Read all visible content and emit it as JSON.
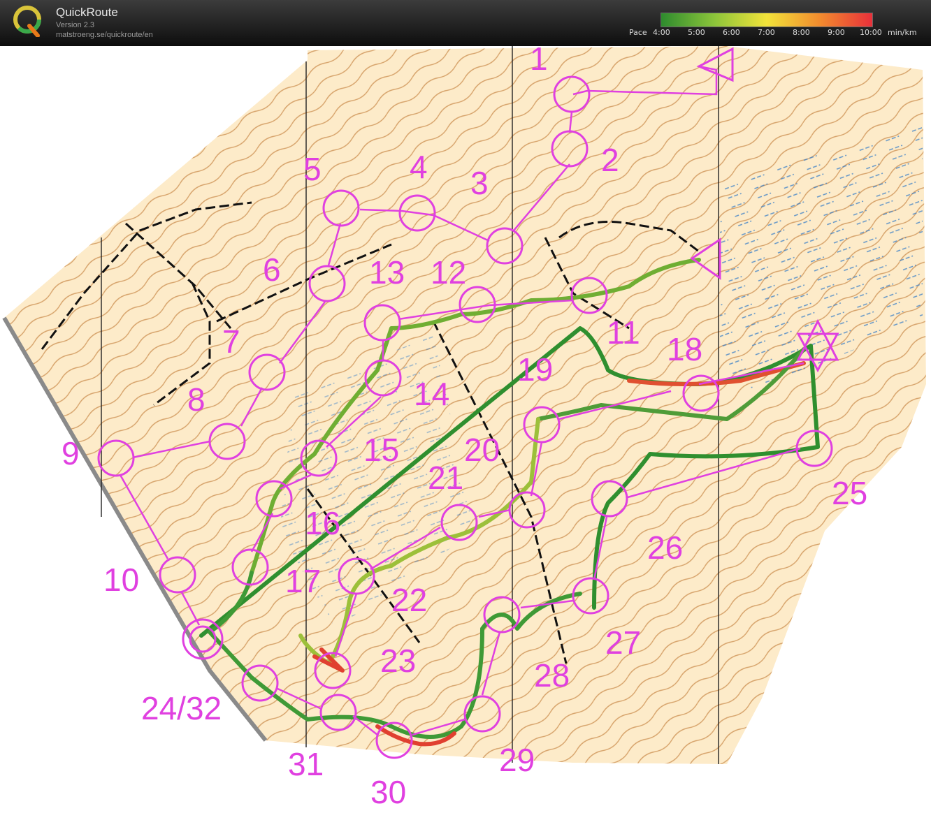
{
  "header": {
    "title": "QuickRoute",
    "version": "Version 2.3",
    "url": "matstroeng.se/quickroute/en",
    "logo_letter": "Q"
  },
  "pace_scale": {
    "label": "Pace",
    "ticks": [
      "4:00",
      "5:00",
      "6:00",
      "7:00",
      "8:00",
      "9:00",
      "10:00"
    ],
    "unit": "min/km",
    "colors": [
      "#2e8b2e",
      "#8bc43a",
      "#f2e33a",
      "#f28c2e",
      "#e8303a"
    ]
  },
  "course": {
    "color": "#e040e0",
    "route_fast_color": "#2f8f2f",
    "route_slow_color": "#e03030",
    "controls": [
      {
        "label": "1"
      },
      {
        "label": "2"
      },
      {
        "label": "3"
      },
      {
        "label": "4"
      },
      {
        "label": "5"
      },
      {
        "label": "6"
      },
      {
        "label": "7"
      },
      {
        "label": "8"
      },
      {
        "label": "9"
      },
      {
        "label": "10"
      },
      {
        "label": "11"
      },
      {
        "label": "12"
      },
      {
        "label": "13"
      },
      {
        "label": "14"
      },
      {
        "label": "15"
      },
      {
        "label": "16"
      },
      {
        "label": "17"
      },
      {
        "label": "18"
      },
      {
        "label": "19"
      },
      {
        "label": "20"
      },
      {
        "label": "21"
      },
      {
        "label": "22"
      },
      {
        "label": "23"
      },
      {
        "label": "24/32"
      },
      {
        "label": "25"
      },
      {
        "label": "26"
      },
      {
        "label": "27"
      },
      {
        "label": "28"
      },
      {
        "label": "29"
      },
      {
        "label": "30"
      },
      {
        "label": "31"
      }
    ]
  }
}
